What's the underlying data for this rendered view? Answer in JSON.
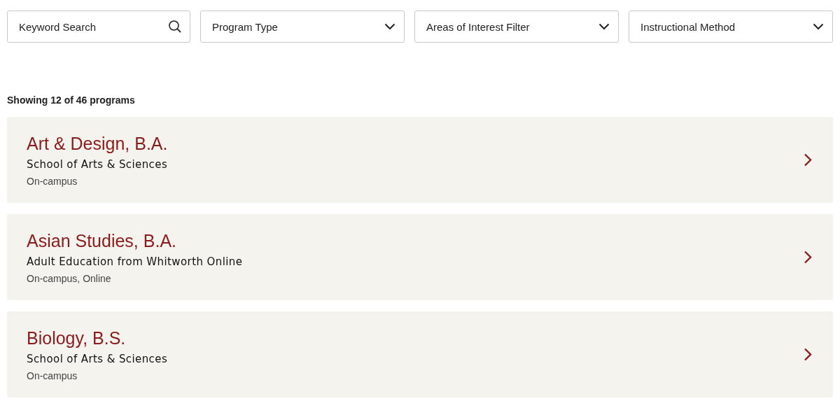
{
  "filters": [
    {
      "kind": "search",
      "placeholder": "Keyword Search"
    },
    {
      "kind": "dropdown",
      "label": "Program Type"
    },
    {
      "kind": "dropdown",
      "label": "Areas of Interest Filter"
    },
    {
      "kind": "dropdown",
      "label": "Instructional Method"
    }
  ],
  "results_count": "Showing 12 of 46 programs",
  "programs": [
    {
      "title": "Art & Design, B.A.",
      "school": "School of Arts & Sciences",
      "method": "On-campus"
    },
    {
      "title": "Asian Studies, B.A.",
      "school": "Adult Education from Whitworth Online",
      "method": "On-campus, Online"
    },
    {
      "title": "Biology, B.S.",
      "school": "School of Arts & Sciences",
      "method": "On-campus"
    }
  ]
}
